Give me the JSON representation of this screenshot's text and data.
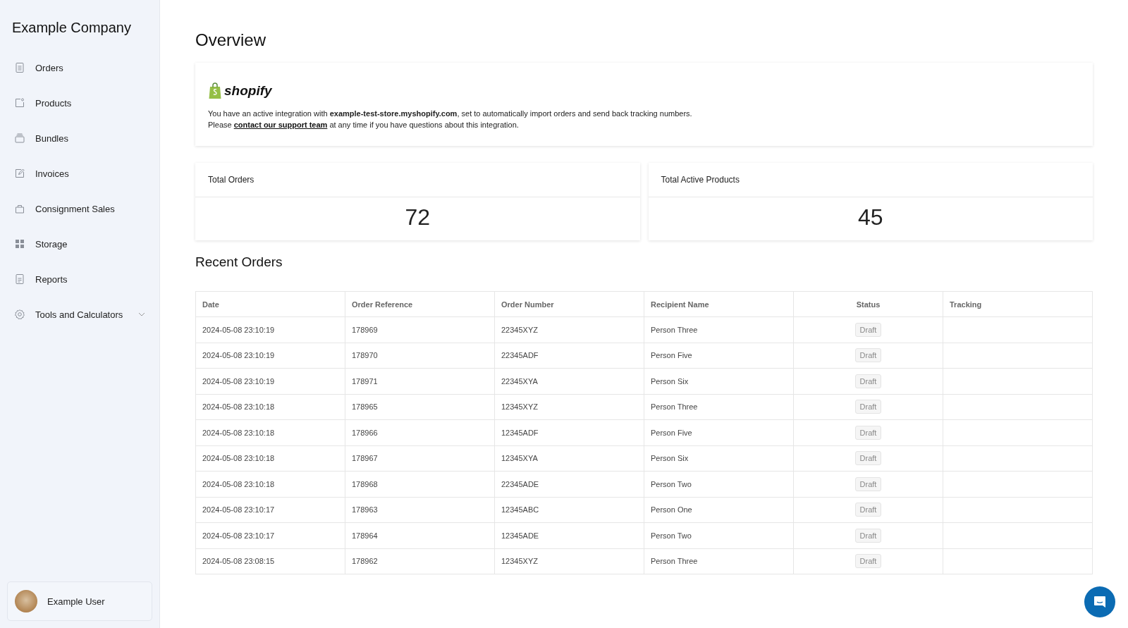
{
  "sidebar": {
    "company": "Example Company",
    "items": [
      {
        "label": "Orders",
        "kind": "link"
      },
      {
        "label": "Products",
        "kind": "link"
      },
      {
        "label": "Bundles",
        "kind": "link"
      },
      {
        "label": "Invoices",
        "kind": "link"
      },
      {
        "label": "Consignment Sales",
        "kind": "link"
      },
      {
        "label": "Storage",
        "kind": "link"
      },
      {
        "label": "Reports",
        "kind": "link"
      },
      {
        "label": "Tools and Calculators",
        "kind": "submenu"
      }
    ],
    "user": {
      "name": "Example User"
    }
  },
  "page_title": "Overview",
  "integration": {
    "logo_text": "shopify",
    "message": "You have an active integration with **example-test-store.myshopify.com**, set to automatically import orders and send back tracking numbers.",
    "support_prefix": "Please",
    "support_link": "contact our support team",
    "support_suffix": "at any time if you have questions about this integration."
  },
  "stats": [
    {
      "label": "Total Orders",
      "value": "72"
    },
    {
      "label": "Total Active Products",
      "value": "45"
    }
  ],
  "recent_orders": {
    "title": "Recent Orders",
    "columns": [
      "Date",
      "Order Reference",
      "Order Number",
      "Recipient Name",
      "Status",
      "Tracking"
    ],
    "rows": [
      [
        "2024-05-08 23:10:19",
        "178969",
        "22345XYZ",
        "Person Three",
        "Draft",
        ""
      ],
      [
        "2024-05-08 23:10:19",
        "178970",
        "22345ADF",
        "Person Five",
        "Draft",
        ""
      ],
      [
        "2024-05-08 23:10:19",
        "178971",
        "22345XYA",
        "Person Six",
        "Draft",
        ""
      ],
      [
        "2024-05-08 23:10:18",
        "178965",
        "12345XYZ",
        "Person Three",
        "Draft",
        ""
      ],
      [
        "2024-05-08 23:10:18",
        "178966",
        "12345ADF",
        "Person Five",
        "Draft",
        ""
      ],
      [
        "2024-05-08 23:10:18",
        "178967",
        "12345XYA",
        "Person Six",
        "Draft",
        ""
      ],
      [
        "2024-05-08 23:10:18",
        "178968",
        "22345ADE",
        "Person Two",
        "Draft",
        ""
      ],
      [
        "2024-05-08 23:10:17",
        "178963",
        "12345ABC",
        "Person One",
        "Draft",
        ""
      ],
      [
        "2024-05-08 23:10:17",
        "178964",
        "12345ADE",
        "Person Two",
        "Draft",
        ""
      ],
      [
        "2024-05-08 23:08:15",
        "178962",
        "12345XYZ",
        "Person Three",
        "Draft",
        ""
      ]
    ]
  }
}
